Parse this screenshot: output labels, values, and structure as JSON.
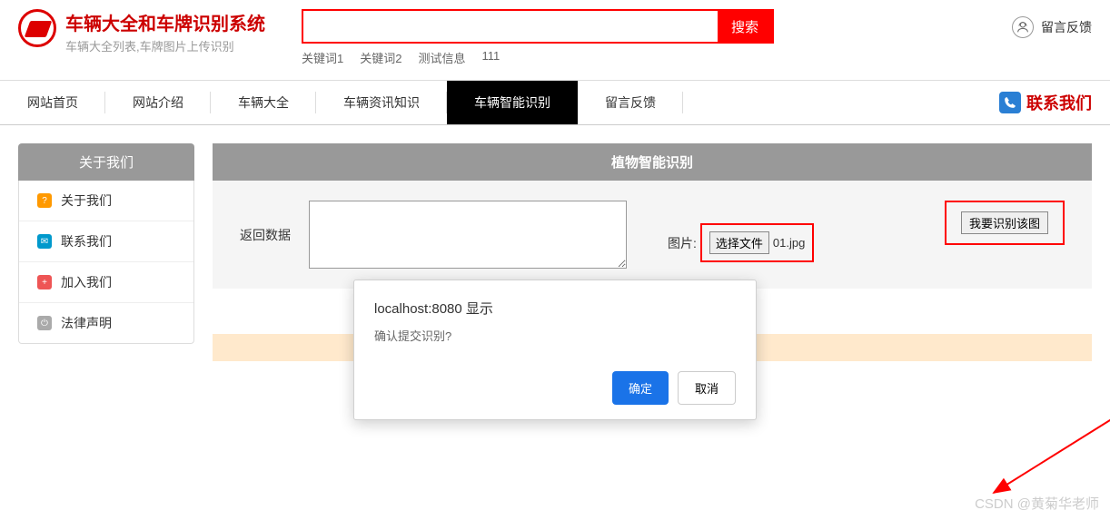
{
  "header": {
    "title": "车辆大全和车牌识别系统",
    "subtitle": "车辆大全列表,车牌图片上传识别",
    "search_button": "搜索",
    "keywords": [
      "关键词1",
      "关键词2",
      "测试信息",
      "111"
    ],
    "feedback_label": "留言反馈"
  },
  "nav": {
    "items": [
      "网站首页",
      "网站介绍",
      "车辆大全",
      "车辆资讯知识",
      "车辆智能识别",
      "留言反馈"
    ],
    "active_index": 4,
    "contact_label": "联系我们"
  },
  "sidebar": {
    "title": "关于我们",
    "items": [
      {
        "label": "关于我们",
        "icon_class": "icon-orange",
        "glyph": "?"
      },
      {
        "label": "联系我们",
        "icon_class": "icon-blue",
        "glyph": "✉"
      },
      {
        "label": "加入我们",
        "icon_class": "icon-red",
        "glyph": "+"
      },
      {
        "label": "法律声明",
        "icon_class": "icon-gray",
        "glyph": "⏻"
      }
    ]
  },
  "content": {
    "panel_title": "植物智能识别",
    "return_label": "返回数据",
    "upload_label": "图片:",
    "file_button_label": "选择文件",
    "file_name": "01.jpg",
    "recognize_button": "我要识别该图"
  },
  "dialog": {
    "title": "localhost:8080 显示",
    "message": "确认提交识别?",
    "ok_label": "确定",
    "cancel_label": "取消"
  },
  "watermark": "CSDN @黄菊华老师"
}
